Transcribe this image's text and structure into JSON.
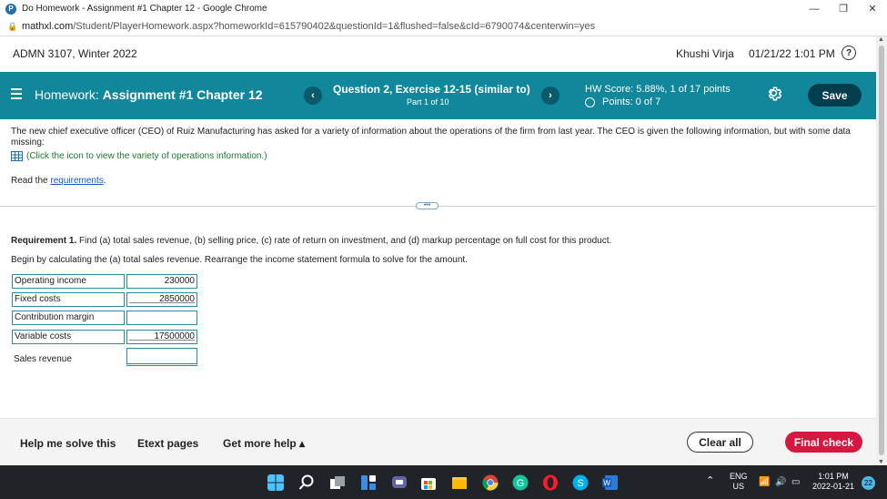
{
  "browser": {
    "window_title": "Do Homework - Assignment #1 Chapter 12 - Google Chrome",
    "favicon_letter": "P",
    "url_host": "mathxl.com",
    "url_path": "/Student/PlayerHomework.aspx?homeworkId=615790402&questionId=1&flushed=false&cId=6790074&centerwin=yes",
    "controls": {
      "minimize": "—",
      "restore": "❐",
      "close": "✕"
    }
  },
  "header": {
    "course": "ADMN 3107, Winter 2022",
    "user": "Khushi Virja",
    "datetime": "01/21/22 1:01 PM",
    "help_icon": "?"
  },
  "hw_bar": {
    "homework_prefix": "Homework:",
    "assignment": "Assignment #1 Chapter 12",
    "prev": "‹",
    "next": "›",
    "question_title": "Question 2, Exercise 12-15 (similar to)",
    "part": "Part 1 of 10",
    "hw_score": "HW Score: 5.88%, 1 of 17 points",
    "points": "Points: 0 of 7",
    "save_label": "Save",
    "accent_color": "#11879c"
  },
  "content": {
    "intro": "The new chief executive officer (CEO) of Ruiz Manufacturing has asked for a variety of information about the operations of the firm from last year. The CEO is given the following information, but with some data missing:",
    "click_icon_text": "(Click the icon to view the variety of operations information.)",
    "read_prefix": "Read the ",
    "requirements_link": "requirements",
    "read_suffix": ".",
    "expander": "•••",
    "req1_label": "Requirement 1.",
    "req1_text": " Find (a) total sales revenue, (b) selling price, (c) rate of return on investment, and (d) markup percentage on full cost for this product.",
    "begin_text": "Begin by calculating the (a) total sales revenue. Rearrange the income statement formula to solve for the amount.",
    "rows": [
      {
        "label": "Operating income",
        "value": "230000"
      },
      {
        "label": "Fixed costs",
        "value": "2850000"
      },
      {
        "label": "Contribution margin",
        "value": ""
      },
      {
        "label": "Variable costs",
        "value": "17500000"
      },
      {
        "label": "Sales revenue",
        "value": ""
      }
    ]
  },
  "bottom_bar": {
    "help_solve": "Help me solve this",
    "etext": "Etext pages",
    "more_help": "Get more help ▴",
    "clear_all": "Clear all",
    "final_check": "Final check"
  },
  "taskbar": {
    "lang": "ENG",
    "region": "US",
    "time": "1:01 PM",
    "date": "2022-01-21",
    "notifications": "22",
    "icons": [
      "windows-start-icon",
      "search-icon",
      "task-view-icon",
      "widgets-icon",
      "teams-chat-icon",
      "store-icon",
      "file-explorer-icon",
      "chrome-icon",
      "grammarly-icon",
      "opera-icon",
      "skype-icon",
      "word-icon"
    ]
  }
}
